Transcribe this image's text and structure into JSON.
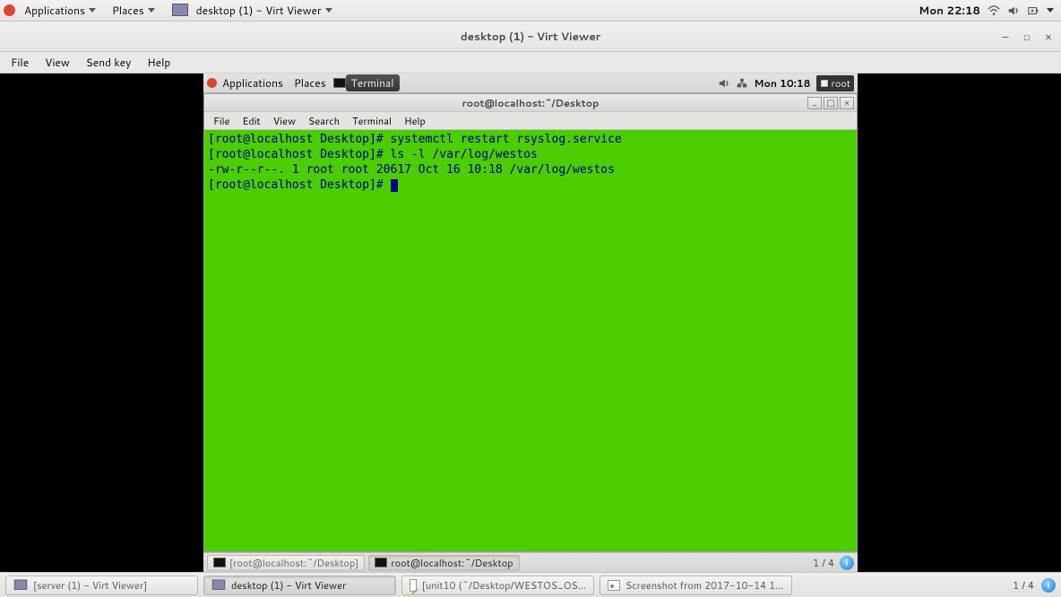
{
  "host": {
    "menus": {
      "applications": "Applications",
      "places": "Places"
    },
    "running_tab": "desktop (1) - Virt Viewer",
    "clock": "Mon 22:18",
    "taskbar": [
      {
        "label": "[server (1) - Virt Viewer]",
        "active": false,
        "icon": "vm"
      },
      {
        "label": "desktop (1) - Virt Viewer",
        "active": true,
        "icon": "vm"
      },
      {
        "label": "[unit10 (~/Desktop/WESTOS_OS...",
        "active": false,
        "icon": "gedit"
      },
      {
        "label": "Screenshot from 2017-10-14 1...",
        "active": false,
        "icon": "image"
      }
    ],
    "workspace": "1 / 4"
  },
  "virt": {
    "title": "desktop (1) - Virt Viewer",
    "menus": [
      "File",
      "View",
      "Send key",
      "Help"
    ]
  },
  "guest": {
    "menus": {
      "applications": "Applications",
      "places": "Places",
      "terminal": "Terminal"
    },
    "clock": "Mon 10:18",
    "user": "root",
    "taskbar": [
      {
        "label": "[root@localhost:~/Desktop]",
        "active": false
      },
      {
        "label": "root@localhost:~/Desktop",
        "active": true
      }
    ],
    "workspace": "1 / 4"
  },
  "terminal": {
    "title": "root@localhost:~/Desktop",
    "menus": [
      "File",
      "Edit",
      "View",
      "Search",
      "Terminal",
      "Help"
    ],
    "lines": [
      "[root@localhost Desktop]# systemctl restart rsyslog.service",
      "[root@localhost Desktop]# ls -l /var/log/westos",
      "-rw-r--r--. 1 root root 20617 Oct 16 10:18 /var/log/westos",
      "[root@localhost Desktop]# "
    ]
  }
}
